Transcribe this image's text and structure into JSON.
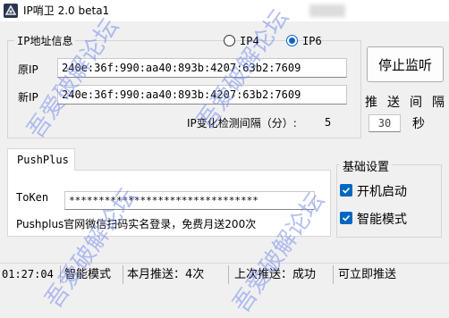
{
  "window": {
    "title": "IP哨卫 2.0 beta1"
  },
  "ip_group": {
    "legend": "IP地址信息",
    "radio_ipv4": "IP4",
    "radio_ipv6": "IP6",
    "old_ip_label": "原IP",
    "old_ip_value": "240e:36f:990:aa40:893b:4207:63b2:7609",
    "new_ip_label": "新IP",
    "new_ip_value": "240e:36f:990:aa40:893b:4207:63b2:7609",
    "interval_label": "IP变化检测间隔（分）:",
    "interval_value": "5"
  },
  "stop_button": "停止监听",
  "push_interval": {
    "label": "推送间隔",
    "value": "30",
    "unit": "秒"
  },
  "pushplus": {
    "tab": "PushPlus",
    "token_label": "ToKen",
    "token_value": "********************************",
    "note": "Pushplus官网微信扫码实名登录，免费月送200次"
  },
  "basic_settings": {
    "legend": "基础设置",
    "autostart": "开机启动",
    "smart_mode": "智能模式",
    "autostart_checked": true,
    "smart_mode_checked": true
  },
  "status_bar": {
    "time": "01:27:04",
    "mode": "智能模式",
    "monthly_push": "本月推送：4次",
    "last_push": "上次推送：成功",
    "push_now": "可立即推送"
  },
  "watermark": "吾爱破解论坛"
}
